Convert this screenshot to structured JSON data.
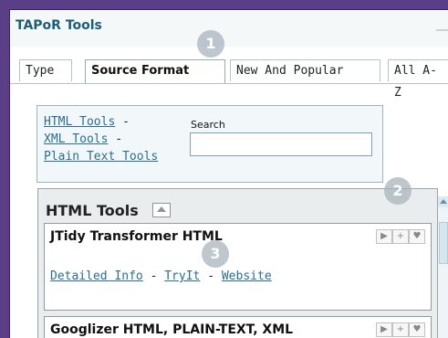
{
  "window": {
    "title": "TAPoR Tools"
  },
  "tabs": [
    {
      "label": "Type"
    },
    {
      "label": "Source Format"
    },
    {
      "label": "New And Popular"
    },
    {
      "label": "All A-Z"
    }
  ],
  "badges": [
    "1",
    "2",
    "3"
  ],
  "links": {
    "html": "HTML Tools",
    "xml": "XML Tools",
    "plain": "Plain Text Tools",
    "separator": "-"
  },
  "search": {
    "label": "Search",
    "value": "",
    "placeholder": ""
  },
  "section": {
    "title": "HTML Tools"
  },
  "tools": [
    {
      "name": "JTidy Transformer HTML",
      "details_label": "Detailed Info",
      "tryit_label": "TryIt",
      "website_label": "Website",
      "separator": "-"
    },
    {
      "name": "Googlizer HTML, PLAIN-TEXT, XML"
    }
  ],
  "actions": {
    "play": "▶",
    "add": "+",
    "favorite": "♥"
  }
}
